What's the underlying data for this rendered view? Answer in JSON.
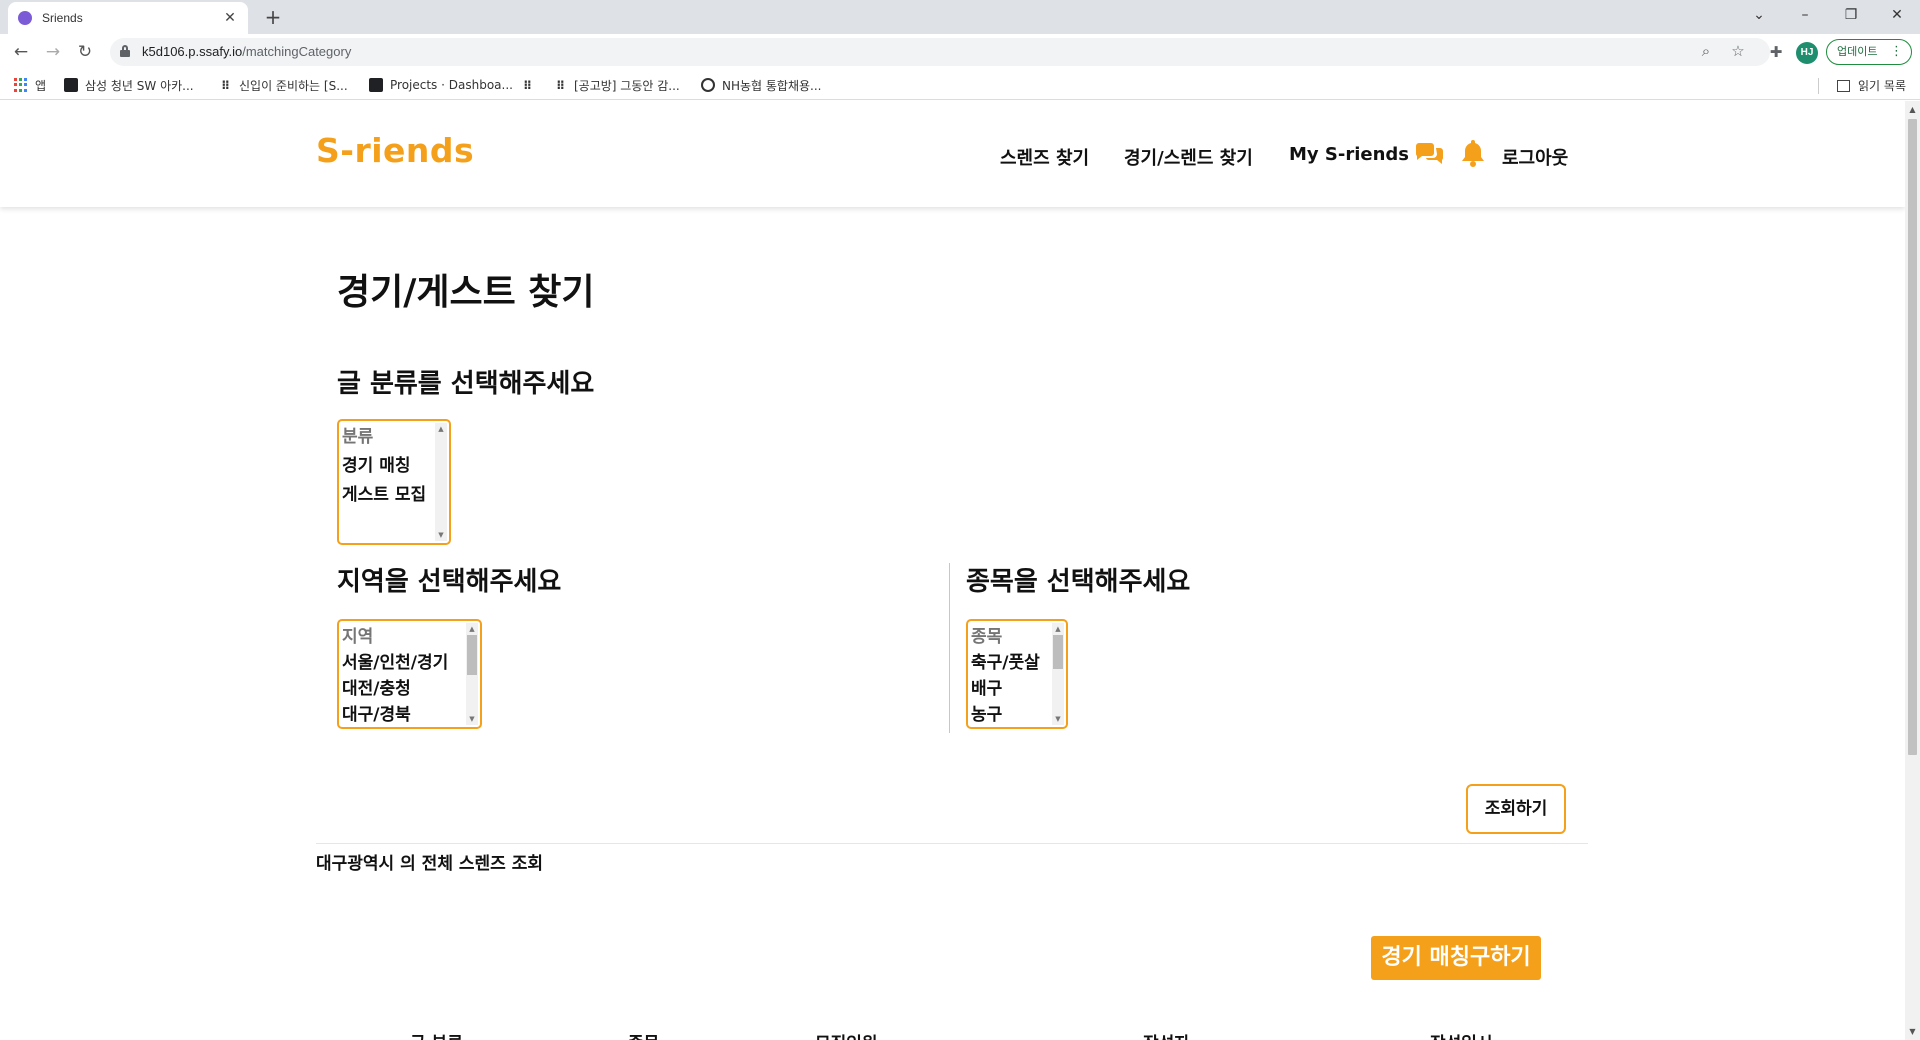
{
  "browser": {
    "tab_title": "Sriends",
    "url_host": "k5d106.p.ssafy.io",
    "url_path": "/matchingCategory",
    "update_label": "업데이트",
    "avatar_initials": "HJ",
    "bookmarks": [
      {
        "label": "앱",
        "icon": "apps-grid-icon"
      },
      {
        "label": "삼성 청년 SW 아카...",
        "icon": "document-icon"
      },
      {
        "label": "신입이 준비하는 [S...",
        "icon": "dots-icon"
      },
      {
        "label": "Projects · Dashboa...",
        "icon": "document-icon"
      },
      {
        "label": "",
        "icon": "dots-icon"
      },
      {
        "label": "[공고방] 그동안 감...",
        "icon": "dots-icon"
      },
      {
        "label": "NH농협 통합채용...",
        "icon": "globe-icon"
      }
    ],
    "reading_list": "읽기 목록"
  },
  "header": {
    "logo": "S-riends",
    "nav": {
      "find_friends": "스렌즈 찾기",
      "find_match": "경기/스렌드 찾기",
      "my": "My S-riends",
      "logout": "로그아웃"
    }
  },
  "main": {
    "title": "경기/게스트 찾기",
    "category_heading": "글 분류를 선택해주세요",
    "category_options": [
      "분류",
      "경기 매칭",
      "게스트 모집"
    ],
    "region_heading": "지역을 선택해주세요",
    "region_options": [
      "지역",
      "서울/인천/경기",
      "대전/충청",
      "대구/경북"
    ],
    "sport_heading": "종목을 선택해주세요",
    "sport_options": [
      "종목",
      "축구/풋살",
      "배구",
      "농구"
    ],
    "search_button": "조회하기",
    "result_caption": "대구광역시 의 전체 스렌즈 조회",
    "match_button": "경기 매칭구하기",
    "table_headers": [
      "글 분류",
      "종목",
      "모집인원",
      "작성자",
      "작성일시"
    ]
  },
  "colors": {
    "accent": "#f5a01a"
  }
}
